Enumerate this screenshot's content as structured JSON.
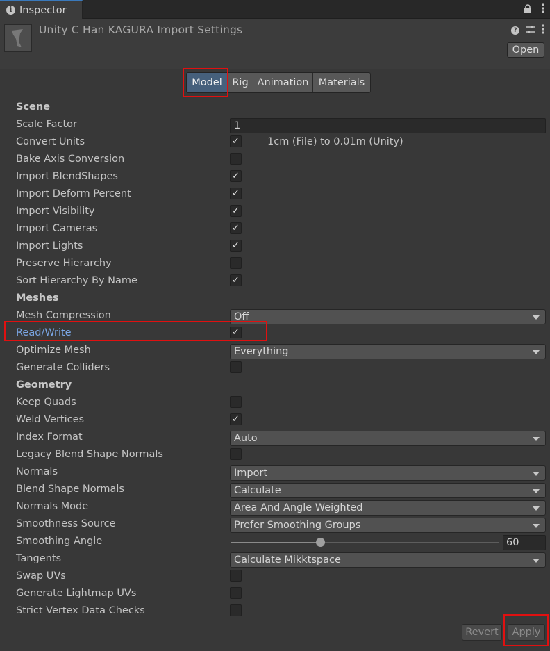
{
  "window": {
    "tab_label": "Inspector",
    "tab_icon": "info-icon"
  },
  "header": {
    "title": "Unity C Han KAGURA Import Settings",
    "open_label": "Open",
    "icons": [
      "help-icon",
      "preset-icon",
      "more-vertical-icon"
    ]
  },
  "tabs": [
    {
      "label": "Model",
      "active": true
    },
    {
      "label": "Rig",
      "active": false
    },
    {
      "label": "Animation",
      "active": false
    },
    {
      "label": "Materials",
      "active": false
    }
  ],
  "rows": [
    {
      "type": "section",
      "label": "Scene"
    },
    {
      "type": "text",
      "label": "Scale Factor",
      "value": "1"
    },
    {
      "type": "check",
      "label": "Convert Units",
      "checked": true,
      "note": "1cm (File) to 0.01m (Unity)"
    },
    {
      "type": "check",
      "label": "Bake Axis Conversion",
      "checked": false
    },
    {
      "type": "check",
      "label": "Import BlendShapes",
      "checked": true
    },
    {
      "type": "check",
      "label": "Import Deform Percent",
      "checked": true
    },
    {
      "type": "check",
      "label": "Import Visibility",
      "checked": true
    },
    {
      "type": "check",
      "label": "Import Cameras",
      "checked": true
    },
    {
      "type": "check",
      "label": "Import Lights",
      "checked": true
    },
    {
      "type": "check",
      "label": "Preserve Hierarchy",
      "checked": false
    },
    {
      "type": "check",
      "label": "Sort Hierarchy By Name",
      "checked": true
    },
    {
      "type": "section",
      "label": "Meshes"
    },
    {
      "type": "dropdown",
      "label": "Mesh Compression",
      "value": "Off"
    },
    {
      "type": "check",
      "label": "Read/Write",
      "checked": true,
      "highlight": true
    },
    {
      "type": "dropdown",
      "label": "Optimize Mesh",
      "value": "Everything"
    },
    {
      "type": "check",
      "label": "Generate Colliders",
      "checked": false
    },
    {
      "type": "section",
      "label": "Geometry"
    },
    {
      "type": "check",
      "label": "Keep Quads",
      "checked": false
    },
    {
      "type": "check",
      "label": "Weld Vertices",
      "checked": true
    },
    {
      "type": "dropdown",
      "label": "Index Format",
      "value": "Auto"
    },
    {
      "type": "check",
      "label": "Legacy Blend Shape Normals",
      "checked": false
    },
    {
      "type": "dropdown",
      "label": "Normals",
      "value": "Import"
    },
    {
      "type": "dropdown",
      "label": "Blend Shape Normals",
      "value": "Calculate"
    },
    {
      "type": "dropdown",
      "label": "Normals Mode",
      "value": "Area And Angle Weighted"
    },
    {
      "type": "dropdown",
      "label": "Smoothness Source",
      "value": "Prefer Smoothing Groups"
    },
    {
      "type": "slider",
      "label": "Smoothing Angle",
      "value": "60",
      "fraction": 0.3333
    },
    {
      "type": "dropdown",
      "label": "Tangents",
      "value": "Calculate Mikktspace"
    },
    {
      "type": "check",
      "label": "Swap UVs",
      "checked": false
    },
    {
      "type": "check",
      "label": "Generate Lightmap UVs",
      "checked": false
    },
    {
      "type": "check",
      "label": "Strict Vertex Data Checks",
      "checked": false
    }
  ],
  "footer": {
    "revert_label": "Revert",
    "apply_label": "Apply"
  },
  "colors": {
    "highlight": "#e01010",
    "accent": "#3a79bb",
    "active_tab": "#46607c",
    "highlight_label": "#7ba7e6"
  }
}
